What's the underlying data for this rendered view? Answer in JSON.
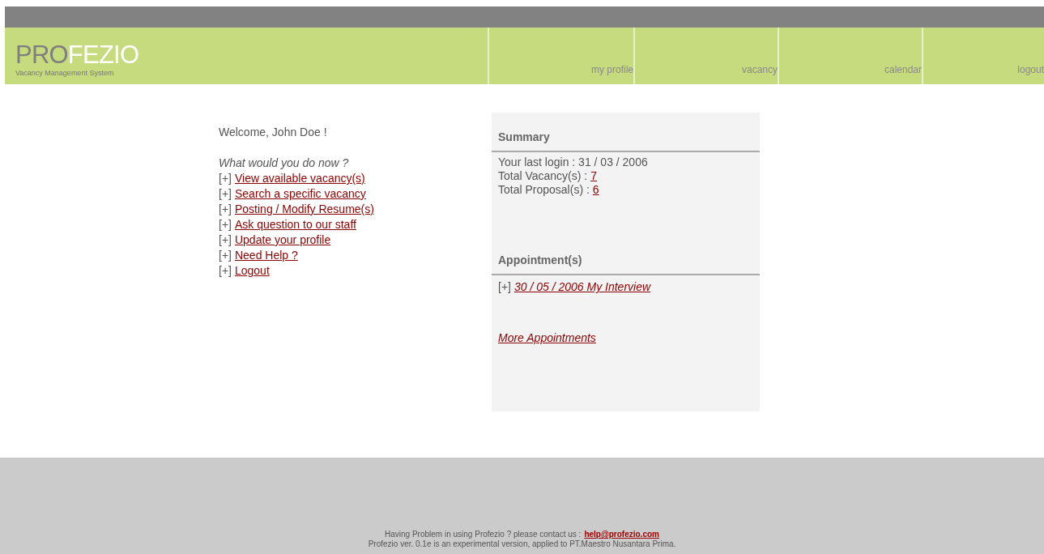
{
  "header": {
    "logo": {
      "dark_part": "PRO",
      "light_part": "FEZIO"
    },
    "tagline": "Vacancy Management System",
    "nav": [
      {
        "label": "my profile"
      },
      {
        "label": "vacancy"
      },
      {
        "label": "calendar"
      },
      {
        "label": "logout"
      }
    ]
  },
  "welcome": "Welcome, John Doe !",
  "prompt": "What would you do now ?",
  "actions": [
    {
      "marker": "[+]",
      "label": "View available vacancy(s)"
    },
    {
      "marker": "[+]",
      "label": "Search a specific vacancy"
    },
    {
      "marker": "[+]",
      "label": "Posting / Modify Resume(s)"
    },
    {
      "marker": "[+]",
      "label": "Ask question to our staff"
    },
    {
      "marker": "[+]",
      "label": "Update your profile"
    },
    {
      "marker": "[+]",
      "label": "Need Help ?"
    },
    {
      "marker": "[+]",
      "label": "Logout"
    }
  ],
  "summary": {
    "title": "Summary",
    "rows": [
      {
        "kind": "text",
        "label": "Your last login : 31 / 03 / 2006"
      },
      {
        "kind": "link",
        "label": "Total Vacancy(s) :",
        "value": "7"
      },
      {
        "kind": "link",
        "label": "Total Proposal(s) :",
        "value": "6"
      }
    ]
  },
  "appointments": {
    "title": "Appointment(s)",
    "items": [
      {
        "marker": "[+]",
        "label": "30 / 05 / 2006 My Interview"
      }
    ],
    "more": "More Appointments"
  },
  "footer": {
    "contact": "Having Problem in using Profezio ? please contact us :",
    "email": "help@profezio.com",
    "version": "Profezio ver. 0.1e is an experimental version, applied to PT.Maestro Nusantara Prima."
  }
}
